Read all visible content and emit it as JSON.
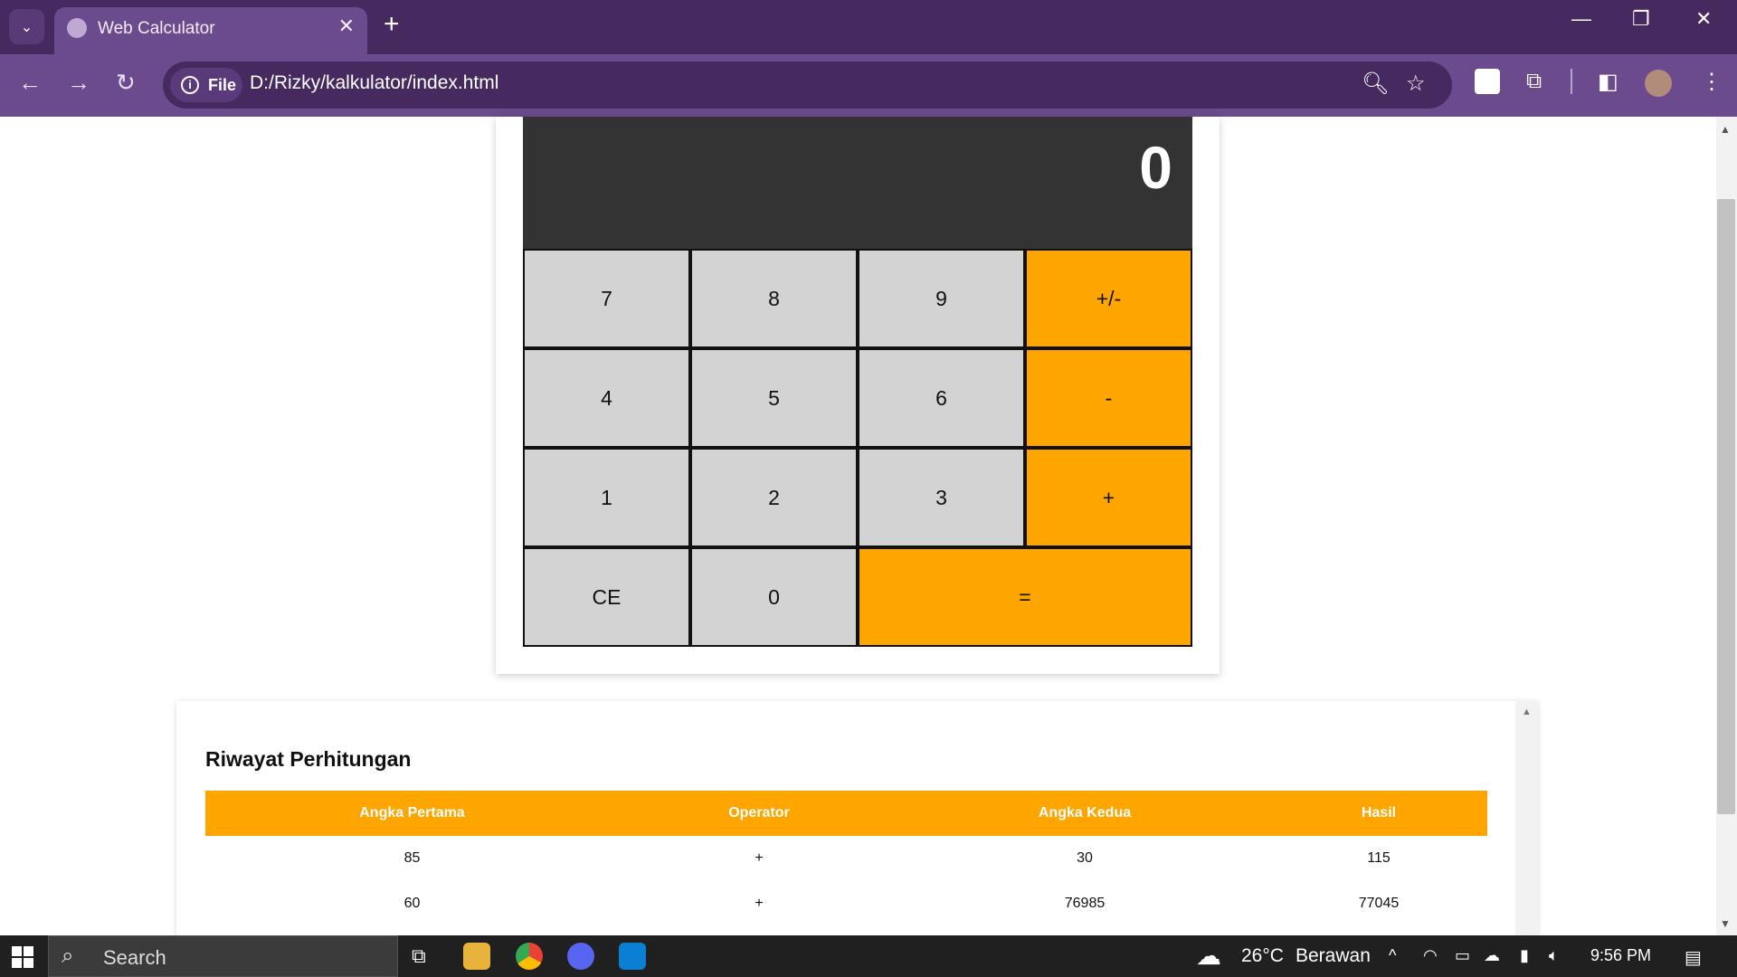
{
  "browser": {
    "tab_title": "Web Calculator",
    "chip_label": "File",
    "url": "D:/Rizky/kalkulator/index.html"
  },
  "calculator": {
    "display": "0",
    "keys": {
      "k7": "7",
      "k8": "8",
      "k9": "9",
      "negate": "+/-",
      "k4": "4",
      "k5": "5",
      "k6": "6",
      "minus": "-",
      "k1": "1",
      "k2": "2",
      "k3": "3",
      "plus": "+",
      "clear": "CE",
      "k0": "0",
      "equals": "="
    }
  },
  "history": {
    "title": "Riwayat Perhitungan",
    "headers": [
      "Angka Pertama",
      "Operator",
      "Angka Kedua",
      "Hasil"
    ],
    "rows": [
      [
        "85",
        "+",
        "30",
        "115"
      ],
      [
        "60",
        "+",
        "76985",
        "77045"
      ]
    ]
  },
  "taskbar": {
    "search_placeholder": "Search",
    "temperature": "26°C",
    "weather": "Berawan",
    "time": "9:56 PM"
  },
  "colors": {
    "accent_orange": "#ffa500",
    "display_bg": "#333333",
    "key_bg": "#d3d3d3",
    "browser_frame": "#6b4a8e"
  }
}
